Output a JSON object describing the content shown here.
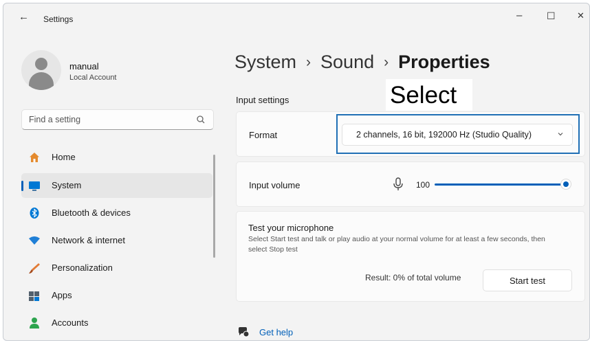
{
  "window": {
    "title": "Settings",
    "back_glyph": "←",
    "minimize_glyph": "–",
    "maximize_glyph": "☐",
    "close_glyph": "✕"
  },
  "profile": {
    "name": "manual",
    "account_type": "Local Account"
  },
  "search": {
    "placeholder": "Find a setting",
    "icon": "search-icon"
  },
  "sidebar": {
    "items": [
      {
        "label": "Home",
        "icon": "home-icon",
        "color": "#e48a2d"
      },
      {
        "label": "System",
        "icon": "system-icon",
        "color": "#0078d4",
        "active": true
      },
      {
        "label": "Bluetooth & devices",
        "icon": "bluetooth-icon",
        "color": "#0078d4"
      },
      {
        "label": "Network & internet",
        "icon": "network-icon",
        "color": "#1f7fd6"
      },
      {
        "label": "Personalization",
        "icon": "brush-icon",
        "color": "#e27b35"
      },
      {
        "label": "Apps",
        "icon": "apps-icon",
        "color": "#52606d"
      },
      {
        "label": "Accounts",
        "icon": "accounts-icon",
        "color": "#2da44e"
      }
    ]
  },
  "breadcrumb": {
    "items": [
      "System",
      "Sound"
    ],
    "current": "Properties",
    "separator": "›"
  },
  "section_title": "Input settings",
  "overlay_label": "Select",
  "format": {
    "label": "Format",
    "value": "2 channels, 16 bit, 192000 Hz (Studio Quality)"
  },
  "input_volume": {
    "label": "Input volume",
    "value": "100",
    "level_percent": 100
  },
  "test": {
    "title": "Test your microphone",
    "description": "Select Start test and talk or play audio at your normal volume for at least a few seconds, then select Stop test",
    "result": "Result: 0% of total volume",
    "button": "Start test"
  },
  "help": {
    "label": "Get help"
  },
  "colors": {
    "accent": "#005fb8",
    "highlight_border": "#1f6fb5",
    "window_bg": "#f3f3f3"
  }
}
